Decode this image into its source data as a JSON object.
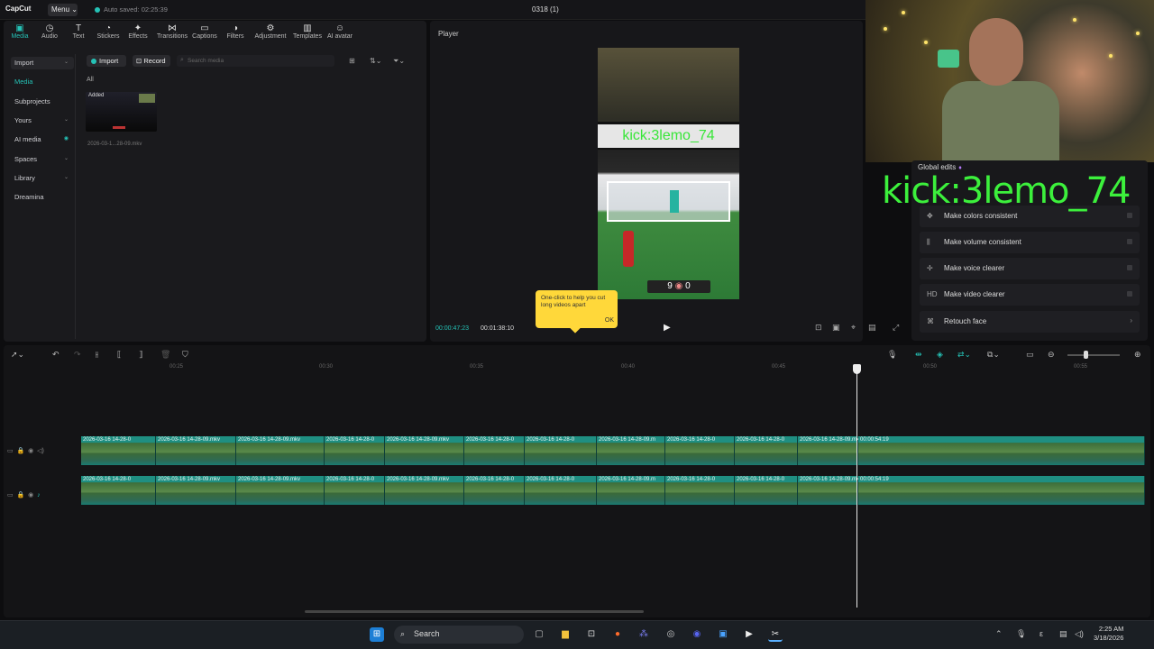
{
  "app": {
    "logo": "CapCut",
    "menu": "Menu",
    "autosave": "Auto saved: 02:25:39",
    "project": "0318 (1)"
  },
  "toolbar": [
    {
      "icon": "media-icon",
      "label": "Media"
    },
    {
      "icon": "audio-icon",
      "label": "Audio"
    },
    {
      "icon": "text-icon",
      "label": "Text"
    },
    {
      "icon": "stickers-icon",
      "label": "Stickers"
    },
    {
      "icon": "effects-icon",
      "label": "Effects"
    },
    {
      "icon": "transitions-icon",
      "label": "Transitions"
    },
    {
      "icon": "captions-icon",
      "label": "Captions"
    },
    {
      "icon": "filters-icon",
      "label": "Filters"
    },
    {
      "icon": "adjustment-icon",
      "label": "Adjustment"
    },
    {
      "icon": "templates-icon",
      "label": "Templates"
    },
    {
      "icon": "ai-avatar-icon",
      "label": "AI avatar"
    }
  ],
  "leftnav": [
    "Import",
    "Media",
    "Subprojects",
    "Yours",
    "AI media",
    "Spaces",
    "Library",
    "Dreamina"
  ],
  "media": {
    "import_btn": "Import",
    "record_btn": "Record",
    "search_placeholder": "Search media",
    "filter_all": "All",
    "thumb_added": "Added",
    "thumb_name": "2026-03-1...28-09.mkv"
  },
  "player": {
    "label": "Player",
    "overlay_caption": "kick:3lemo_74",
    "score_left": "9",
    "score_right": "0",
    "tip_text": "One-click to help you cut long videos apart",
    "tip_ok": "OK",
    "time_current": "00:00:47:23",
    "time_total": "00:01:38:10"
  },
  "inspector": {
    "title": "Global edits",
    "rows": [
      {
        "icon": "palette-icon",
        "label": "Make colors consistent"
      },
      {
        "icon": "volume-icon",
        "label": "Make volume consistent"
      },
      {
        "icon": "voice-icon",
        "label": "Make voice clearer"
      },
      {
        "icon": "hd-icon",
        "glyph": "HD",
        "label": "Make video clearer"
      },
      {
        "icon": "retouch-icon",
        "label": "Retouch face"
      }
    ]
  },
  "webcam_overlay": "kick:3lemo_74",
  "timeline": {
    "ruler": [
      "00:25",
      "00:30",
      "00:35",
      "00:40",
      "00:45",
      "00:50",
      "00:55"
    ],
    "track1": [
      "2026-03-16 14-28-0",
      "2026-03-16 14-28-09.mkv",
      "2026-03-16 14-28-09.mkv",
      "2026-03-16 14-28-0",
      "2026-03-16 14-28-09.mkv",
      "2026-03-16 14-28-0",
      "2026-03-16 14-28-0",
      "2026-03-16 14-28-09.m",
      "2026-03-16 14-28-0",
      "2026-03-16 14-28-0",
      "2026-03-16 14-28-09.mkv",
      "00:00:54:19"
    ],
    "track2": [
      "2026-03-16 14-28-0",
      "2026-03-16 14-28-09.mkv",
      "2026-03-16 14-28-09.mkv",
      "2026-03-16 14-28-0",
      "2026-03-16 14-28-09.mkv",
      "2026-03-16 14-28-0",
      "2026-03-16 14-28-0",
      "2026-03-16 14-28-09.m",
      "2026-03-16 14-28-0",
      "2026-03-16 14-28-0",
      "2026-03-16 14-28-09.mkv",
      "00:00:54:19"
    ]
  },
  "taskbar": {
    "search": "Search",
    "time": "2:25 AM",
    "date": "3/18/2026"
  },
  "colors": {
    "accent": "#25c2b6",
    "track": "#1a7c72",
    "tip": "#ffd83a",
    "overlay": "#3cf03c"
  }
}
